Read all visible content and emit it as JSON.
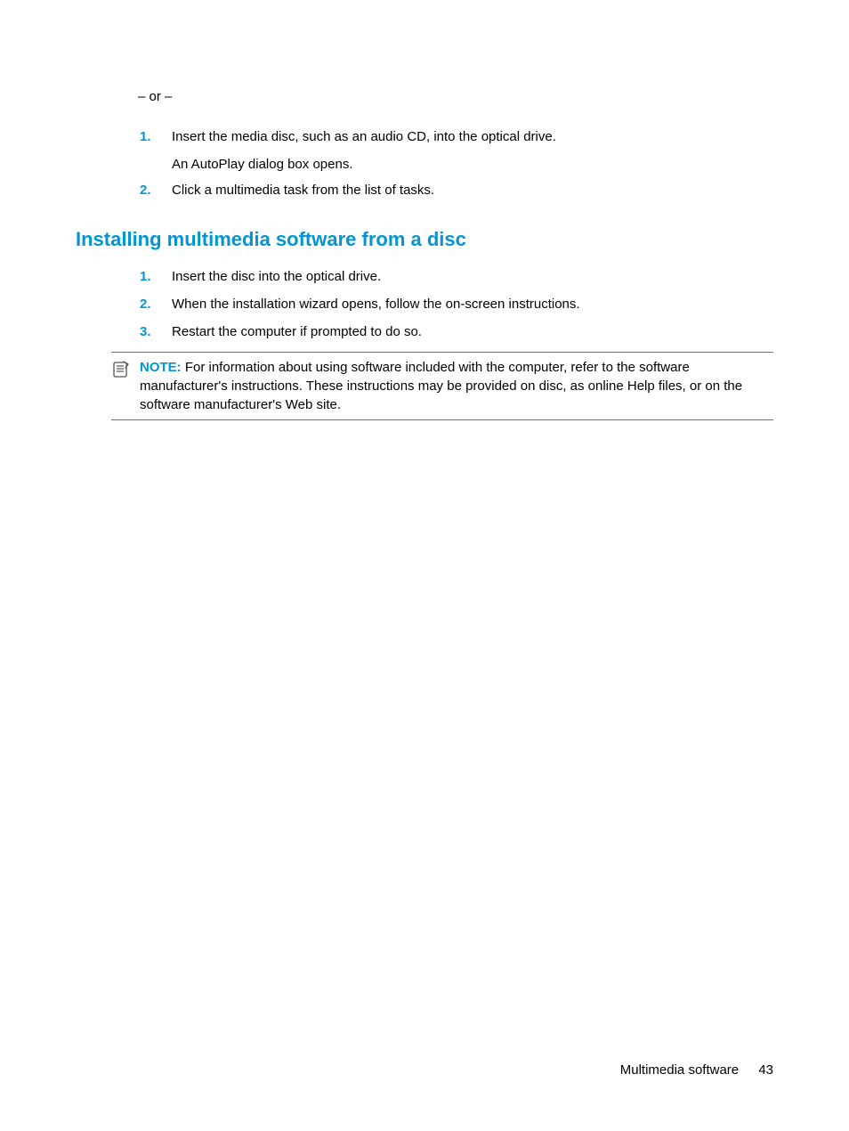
{
  "top": {
    "or": "– or –",
    "items": [
      {
        "num": "1.",
        "text": "Insert the media disc, such as an audio CD, into the optical drive.",
        "sub": "An AutoPlay dialog box opens."
      },
      {
        "num": "2.",
        "text": "Click a multimedia task from the list of tasks."
      }
    ]
  },
  "section": {
    "heading": "Installing multimedia software from a disc",
    "items": [
      {
        "num": "1.",
        "text": "Insert the disc into the optical drive."
      },
      {
        "num": "2.",
        "text": "When the installation wizard opens, follow the on-screen instructions."
      },
      {
        "num": "3.",
        "text": "Restart the computer if prompted to do so."
      }
    ]
  },
  "note": {
    "label": "NOTE:",
    "text": " For information about using software included with the computer, refer to the software manufacturer's instructions. These instructions may be provided on disc, as online Help files, or on the software manufacturer's Web site."
  },
  "footer": {
    "title": "Multimedia software",
    "page": "43"
  }
}
